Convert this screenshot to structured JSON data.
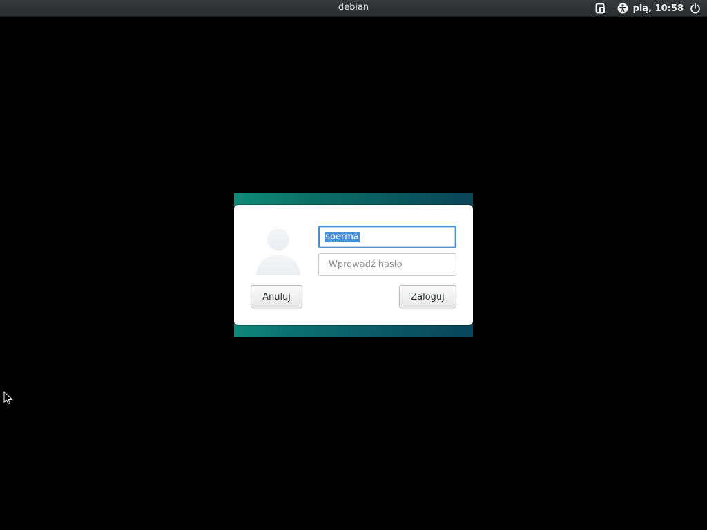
{
  "topbar": {
    "host": "debian",
    "clock": "pią, 10:58",
    "icons": [
      "keyboard-layout-icon",
      "accessibility-icon",
      "power-icon"
    ]
  },
  "login": {
    "username_value": "sperma",
    "password_placeholder": "Wprowadź hasło",
    "cancel_label": "Anuluj",
    "login_label": "Zaloguj"
  },
  "colors": {
    "background": "#000000",
    "topbar": "#2f3334",
    "accent": "#4a90d9",
    "stage_teal": "#0b6f66"
  }
}
